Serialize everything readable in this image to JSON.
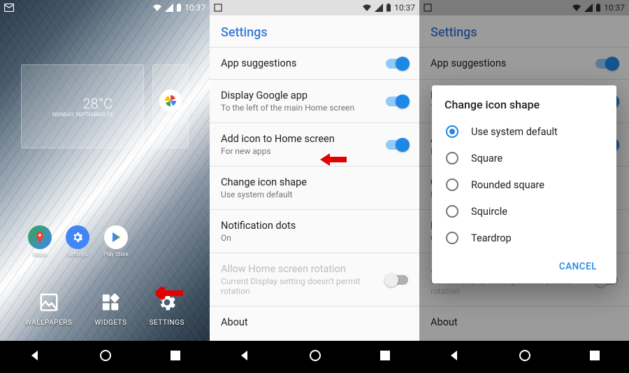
{
  "status": {
    "time": "10:37"
  },
  "home": {
    "weather_temp": "28°C",
    "weather_date": "MONDAY, SEPTEMBER 25",
    "side_app_label": "Photos",
    "dock": [
      {
        "label": "Maps"
      },
      {
        "label": "Settings"
      },
      {
        "label": "Play Store"
      }
    ],
    "options": [
      {
        "label": "WALLPAPERS"
      },
      {
        "label": "WIDGETS"
      },
      {
        "label": "SETTINGS"
      }
    ]
  },
  "settings": {
    "title": "Settings",
    "rows": [
      {
        "title": "App suggestions",
        "sub": "",
        "toggle": true
      },
      {
        "title": "Display Google app",
        "sub": "To the left of the main Home screen",
        "toggle": true
      },
      {
        "title": "Add icon to Home screen",
        "sub": "For new apps",
        "toggle": true
      },
      {
        "title": "Change icon shape",
        "sub": "Use system default"
      },
      {
        "title": "Notification dots",
        "sub": "On"
      },
      {
        "title": "Allow Home screen rotation",
        "sub": "Current Display setting doesn't permit rotation",
        "toggle": false,
        "disabled": true
      },
      {
        "title": "About",
        "sub": ""
      }
    ]
  },
  "dialog": {
    "title": "Change icon shape",
    "options": [
      "Use system default",
      "Square",
      "Rounded square",
      "Squircle",
      "Teardrop"
    ],
    "selected_index": 0,
    "cancel": "CANCEL"
  }
}
